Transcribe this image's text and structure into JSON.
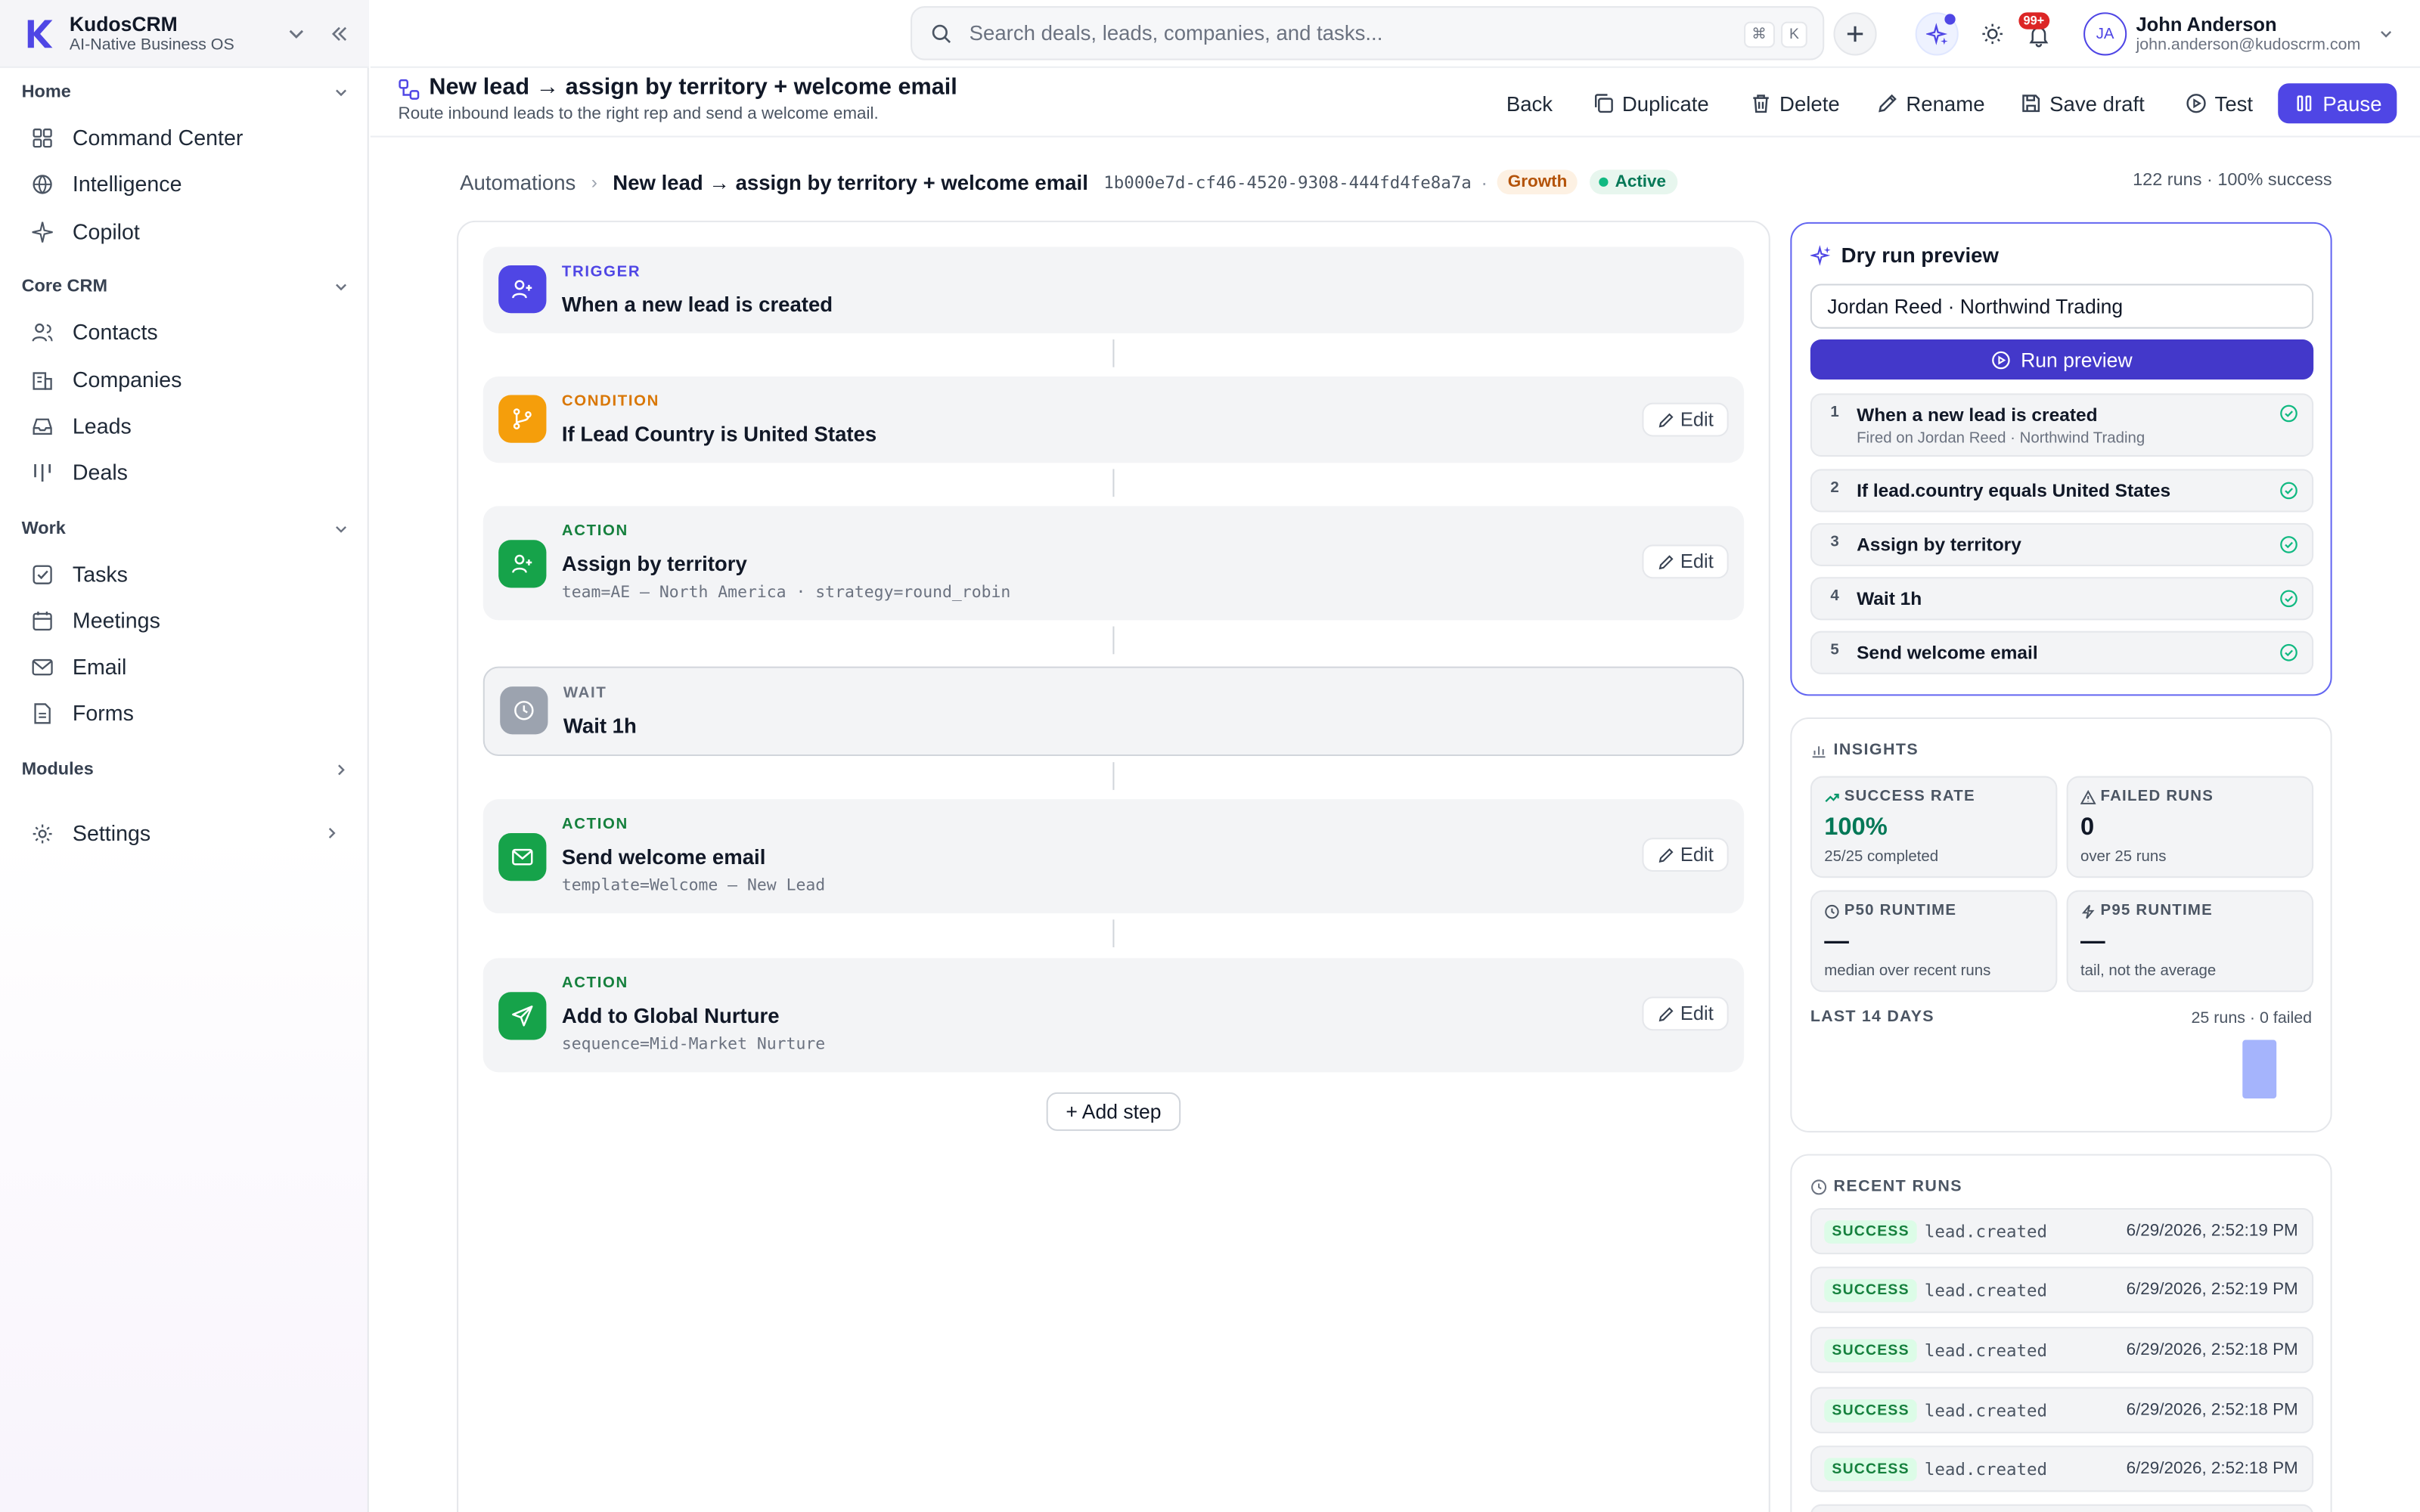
{
  "app": {
    "name": "KudosCRM",
    "tagline": "AI-Native Business OS"
  },
  "sidebar": {
    "sections": [
      {
        "label": "Home",
        "items": [
          {
            "label": "Command Center",
            "icon": "grid-icon"
          },
          {
            "label": "Intelligence",
            "icon": "globe-icon"
          },
          {
            "label": "Copilot",
            "icon": "sparkle-icon"
          }
        ]
      },
      {
        "label": "Core CRM",
        "items": [
          {
            "label": "Contacts",
            "icon": "users-icon"
          },
          {
            "label": "Companies",
            "icon": "building-icon"
          },
          {
            "label": "Leads",
            "icon": "inbox-icon"
          },
          {
            "label": "Deals",
            "icon": "columns-icon"
          }
        ]
      },
      {
        "label": "Work",
        "items": [
          {
            "label": "Tasks",
            "icon": "check-square-icon"
          },
          {
            "label": "Meetings",
            "icon": "calendar-icon"
          },
          {
            "label": "Email",
            "icon": "mail-icon"
          },
          {
            "label": "Forms",
            "icon": "file-icon"
          }
        ]
      },
      {
        "label": "Modules",
        "items": []
      }
    ],
    "settings_label": "Settings"
  },
  "topbar": {
    "search_placeholder": "Search deals, leads, companies, and tasks...",
    "kbd_mod": "⌘",
    "kbd_key": "K",
    "notif_count": "99+",
    "user": {
      "initials": "JA",
      "name": "John Anderson",
      "email": "john.anderson@kudoscrm.com"
    }
  },
  "page": {
    "title": "New lead → assign by territory + welcome email",
    "subtitle": "Route inbound leads to the right rep and send a welcome email.",
    "actions": {
      "back": "Back",
      "duplicate": "Duplicate",
      "delete": "Delete",
      "rename": "Rename",
      "save_draft": "Save draft",
      "test": "Test",
      "pause": "Pause"
    }
  },
  "breadcrumb": {
    "root": "Automations",
    "current": "New lead → assign by territory + welcome email",
    "id": "1b000e7d-cf46-4520-9308-444fd4fe8a7a",
    "tier": "Growth",
    "status": "Active",
    "runs_summary": "122 runs · 100% success"
  },
  "flow": {
    "steps": [
      {
        "kind": "TRIGGER",
        "title": "When a new lead is created",
        "detail": "",
        "icon": "user-plus-icon",
        "color": "#4f46e5",
        "kind_color": "#4f46e5"
      },
      {
        "kind": "CONDITION",
        "title": "If Lead Country is United States",
        "detail": "",
        "icon": "branch-icon",
        "color": "#f59e0b",
        "kind_color": "#d97706"
      },
      {
        "kind": "ACTION",
        "title": "Assign by territory",
        "detail": "team=AE — North America · strategy=round_robin",
        "icon": "user-plus-icon",
        "color": "#16a34a",
        "kind_color": "#15803d"
      },
      {
        "kind": "WAIT",
        "title": "Wait 1h",
        "detail": "",
        "icon": "clock-icon",
        "color": "#9ca3af",
        "kind_color": "#6b7280"
      },
      {
        "kind": "ACTION",
        "title": "Send welcome email",
        "detail": "template=Welcome — New Lead",
        "icon": "mail-icon",
        "color": "#16a34a",
        "kind_color": "#15803d"
      },
      {
        "kind": "ACTION",
        "title": "Add to Global Nurture",
        "detail": "sequence=Mid-Market Nurture",
        "icon": "send-icon",
        "color": "#16a34a",
        "kind_color": "#15803d"
      }
    ],
    "edit_label": "Edit",
    "add_step_label": "+ Add step"
  },
  "dry_run": {
    "title": "Dry run preview",
    "input_value": "Jordan Reed · Northwind Trading",
    "run_label": "Run preview",
    "steps": [
      {
        "num": "1",
        "name": "When a new lead is created",
        "sub": "Fired on Jordan Reed · Northwind Trading"
      },
      {
        "num": "2",
        "name": "If lead.country equals United States",
        "sub": ""
      },
      {
        "num": "3",
        "name": "Assign by territory",
        "sub": ""
      },
      {
        "num": "4",
        "name": "Wait 1h",
        "sub": ""
      },
      {
        "num": "5",
        "name": "Send welcome email",
        "sub": ""
      }
    ]
  },
  "insights": {
    "title": "INSIGHTS",
    "success_rate": {
      "label": "SUCCESS RATE",
      "value": "100%",
      "sub": "25/25 completed"
    },
    "failed_runs": {
      "label": "FAILED RUNS",
      "value": "0",
      "sub": "over 25 runs"
    },
    "p50": {
      "label": "P50 RUNTIME",
      "value": "—",
      "sub": "median over recent runs"
    },
    "p95": {
      "label": "P95 RUNTIME",
      "value": "—",
      "sub": "tail, not the average"
    },
    "last14_label": "LAST 14 DAYS",
    "last14_stat": "25 runs · 0 failed"
  },
  "recent_runs": {
    "title": "RECENT RUNS",
    "runs": [
      {
        "status": "SUCCESS",
        "event": "lead.created",
        "time": "6/29/2026, 2:52:19 PM"
      },
      {
        "status": "SUCCESS",
        "event": "lead.created",
        "time": "6/29/2026, 2:52:19 PM"
      },
      {
        "status": "SUCCESS",
        "event": "lead.created",
        "time": "6/29/2026, 2:52:18 PM"
      },
      {
        "status": "SUCCESS",
        "event": "lead.created",
        "time": "6/29/2026, 2:52:18 PM"
      },
      {
        "status": "SUCCESS",
        "event": "lead.created",
        "time": "6/29/2026, 2:52:18 PM"
      }
    ]
  },
  "colors": {
    "accent": "#4f46e5",
    "success": "#10b981",
    "warning": "#f59e0b"
  }
}
